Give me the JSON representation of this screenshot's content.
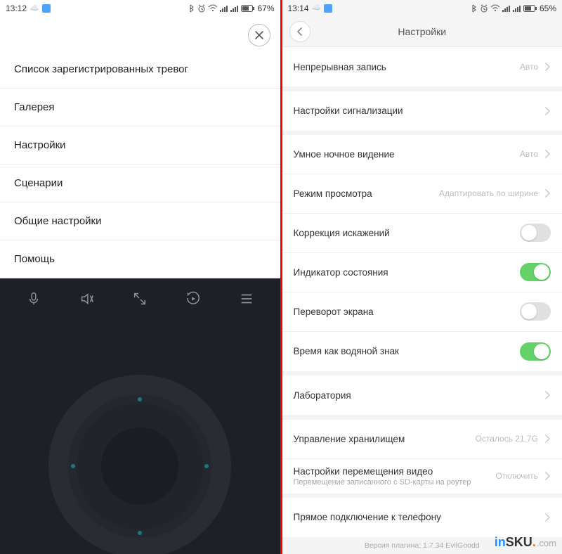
{
  "left": {
    "status": {
      "time": "13:12",
      "battery": "67%"
    },
    "items": [
      {
        "label": "Список зарегистрированных тревог"
      },
      {
        "label": "Галерея"
      },
      {
        "label": "Настройки"
      },
      {
        "label": "Сценарии"
      },
      {
        "label": "Общие настройки"
      },
      {
        "label": "Помощь"
      }
    ]
  },
  "right": {
    "status": {
      "time": "13:14",
      "battery": "65%"
    },
    "title": "Настройки",
    "rows": [
      {
        "label": "Непрерывная запись",
        "value": "Авто",
        "type": "nav"
      },
      {
        "label": "Настройки сигнализации",
        "value": "",
        "type": "nav"
      },
      {
        "label": "Умное ночное видение",
        "value": "Авто",
        "type": "nav"
      },
      {
        "label": "Режим просмотра",
        "value": "Адаптировать по ширине",
        "type": "nav"
      },
      {
        "label": "Коррекция искажений",
        "type": "toggle",
        "on": false
      },
      {
        "label": "Индикатор состояния",
        "type": "toggle",
        "on": true
      },
      {
        "label": "Переворот экрана",
        "type": "toggle",
        "on": false
      },
      {
        "label": "Время как водяной знак",
        "type": "toggle",
        "on": true
      },
      {
        "label": "Лаборатория",
        "type": "nav",
        "value": ""
      },
      {
        "label": "Управление хранилищем",
        "type": "nav",
        "value": "Осталось 21.7G"
      },
      {
        "label": "Настройки перемещения видео",
        "sub": "Перемещение записанного с SD-карты на роутер",
        "type": "nav",
        "value": "Отключить"
      },
      {
        "label": "Прямое подключение к телефону",
        "type": "nav",
        "value": ""
      }
    ],
    "version": "Версия плагина:  1.7.34  EvilGoodd"
  },
  "watermark": {
    "in": "in",
    "sku": "SKU",
    "com": ".com"
  }
}
